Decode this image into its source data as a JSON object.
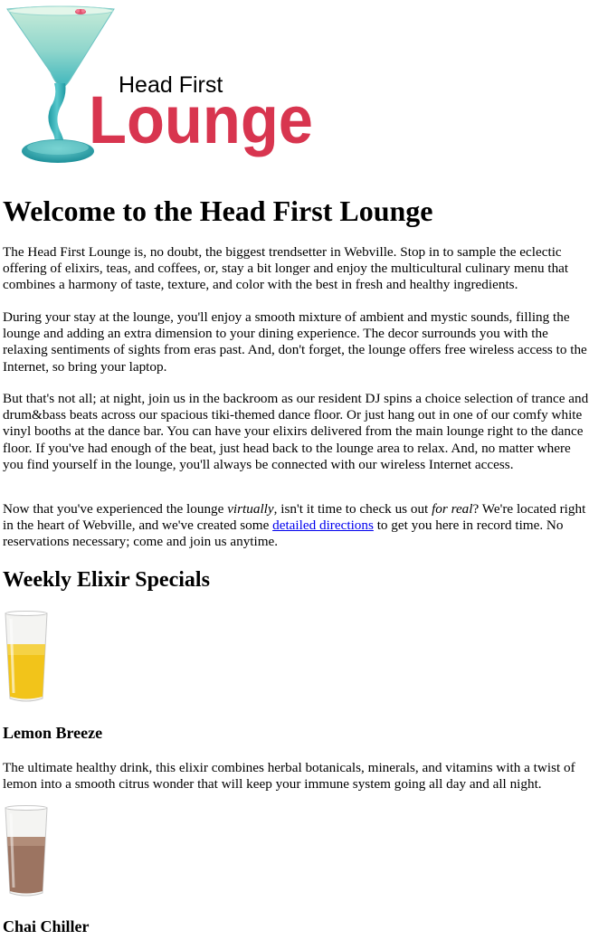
{
  "logo": {
    "line1": "Head First",
    "line2": "Lounge"
  },
  "title": "Welcome to the Head First Lounge",
  "intro": [
    "The Head First Lounge is, no doubt, the biggest trendsetter in Webville. Stop in to sample the eclectic offering of elixirs, teas, and coffees, or, stay a bit longer and enjoy the multicultural culinary menu that combines a harmony of taste, texture, and color with the best in fresh and healthy ingredients.",
    "During your stay at the lounge, you'll enjoy a smooth mixture of ambient and mystic sounds, filling the lounge and adding an extra dimension to your dining experience. The decor surrounds you with the relaxing sentiments of sights from eras past. And, don't forget, the lounge offers free wireless access to the Internet, so bring your laptop.",
    "But that's not all; at night, join us in the backroom as our resident DJ spins a choice selection of trance and drum&bass beats across our spacious tiki-themed dance floor. Or just hang out in one of our comfy white vinyl booths at the dance bar. You can have your elixirs delivered from the main lounge right to the dance floor. If you've had enough of the beat, just head back to the lounge area to relax. And, no matter where you find yourself in the lounge, you'll always be connected with our wireless Internet access."
  ],
  "closing": {
    "part1": "Now that you've experienced the lounge ",
    "em1": "virtually",
    "part2": ", isn't it time to check us out ",
    "em2": "for real",
    "part3": "? We're located right in the heart of Webville, and we've created some ",
    "link": "detailed directions",
    "part4": " to get you here in record time. No reservations necessary; come and join us anytime."
  },
  "specials_heading": "Weekly Elixir Specials",
  "specials": [
    {
      "name": "Lemon Breeze",
      "description": "The ultimate healthy drink, this elixir combines herbal botanicals, minerals, and vitamins with a twist of lemon into a smooth citrus wonder that will keep your immune system going all day and all night.",
      "liquid_color": "#f2c41a"
    },
    {
      "name": "Chai Chiller",
      "liquid_color": "#9c7461"
    }
  ],
  "colors": {
    "logo_red": "#d8354f",
    "glass_teal": "#3fb6bc",
    "link": "#0000ee"
  }
}
